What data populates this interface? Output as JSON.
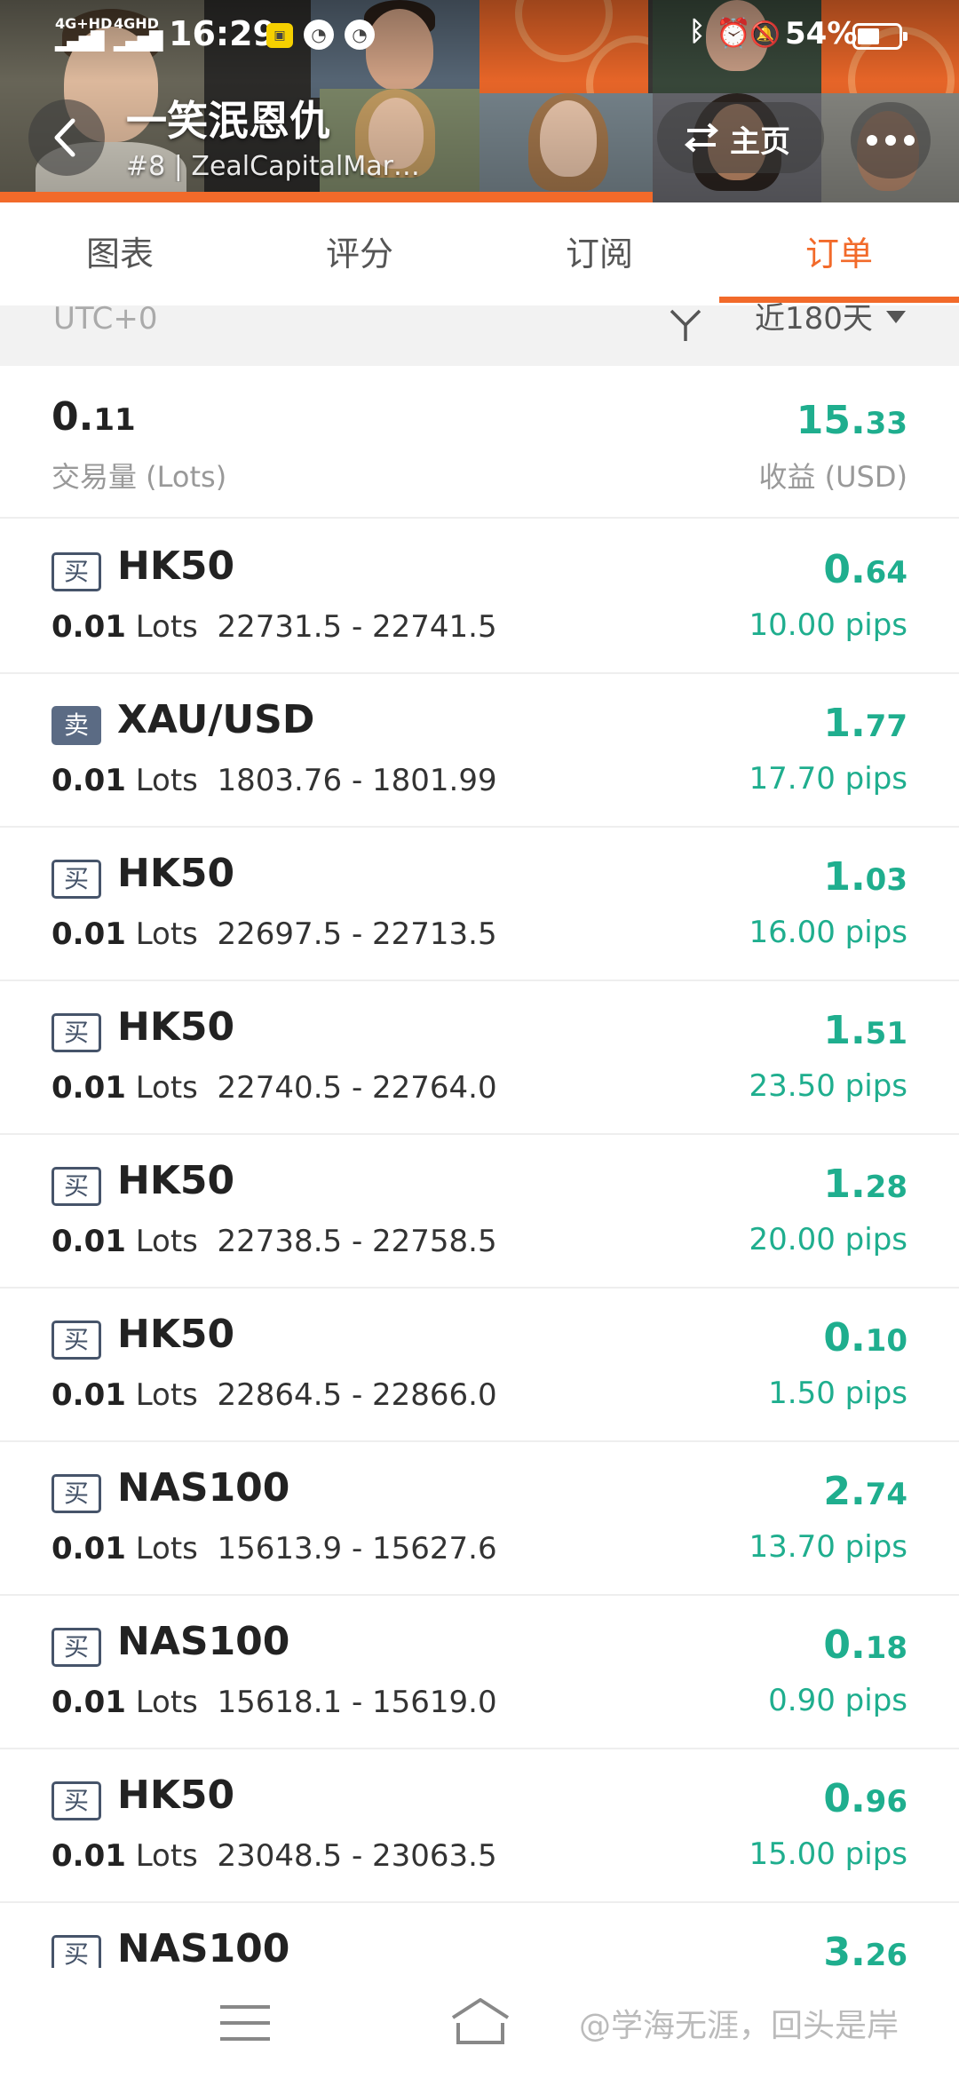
{
  "status_bar": {
    "net1": "4G+HD",
    "net2": "4GHD",
    "time": "16:29",
    "battery": "54%",
    "battery_level": 0.54
  },
  "header": {
    "title": "一笑泯恩仇",
    "subtitle": "#8 | ZealCapitalMar…",
    "home_label": "主页"
  },
  "tabs": [
    "图表",
    "评分",
    "订阅",
    "订单"
  ],
  "active_tab": 3,
  "filter": {
    "timezone": "UTC+0",
    "range": "近180天"
  },
  "summary": {
    "volume_int": "0.",
    "volume_dec": "11",
    "volume_label": "交易量 (Lots)",
    "profit_int": "15.",
    "profit_dec": "33",
    "profit_label": "收益 (USD)"
  },
  "orders": [
    {
      "side": "买",
      "type": "buy",
      "symbol": "HK50",
      "lots": "0.01",
      "unit": "Lots",
      "prices": "22731.5 - 22741.5",
      "pnl_int": "0.",
      "pnl_dec": "64",
      "pips": "10.00 pips"
    },
    {
      "side": "卖",
      "type": "sell",
      "symbol": "XAU/USD",
      "lots": "0.01",
      "unit": "Lots",
      "prices": "1803.76 - 1801.99",
      "pnl_int": "1.",
      "pnl_dec": "77",
      "pips": "17.70 pips"
    },
    {
      "side": "买",
      "type": "buy",
      "symbol": "HK50",
      "lots": "0.01",
      "unit": "Lots",
      "prices": "22697.5 - 22713.5",
      "pnl_int": "1.",
      "pnl_dec": "03",
      "pips": "16.00 pips"
    },
    {
      "side": "买",
      "type": "buy",
      "symbol": "HK50",
      "lots": "0.01",
      "unit": "Lots",
      "prices": "22740.5 - 22764.0",
      "pnl_int": "1.",
      "pnl_dec": "51",
      "pips": "23.50 pips"
    },
    {
      "side": "买",
      "type": "buy",
      "symbol": "HK50",
      "lots": "0.01",
      "unit": "Lots",
      "prices": "22738.5 - 22758.5",
      "pnl_int": "1.",
      "pnl_dec": "28",
      "pips": "20.00 pips"
    },
    {
      "side": "买",
      "type": "buy",
      "symbol": "HK50",
      "lots": "0.01",
      "unit": "Lots",
      "prices": "22864.5 - 22866.0",
      "pnl_int": "0.",
      "pnl_dec": "10",
      "pips": "1.50 pips"
    },
    {
      "side": "买",
      "type": "buy",
      "symbol": "NAS100",
      "lots": "0.01",
      "unit": "Lots",
      "prices": "15613.9 - 15627.6",
      "pnl_int": "2.",
      "pnl_dec": "74",
      "pips": "13.70 pips"
    },
    {
      "side": "买",
      "type": "buy",
      "symbol": "NAS100",
      "lots": "0.01",
      "unit": "Lots",
      "prices": "15618.1 - 15619.0",
      "pnl_int": "0.",
      "pnl_dec": "18",
      "pips": "0.90 pips"
    },
    {
      "side": "买",
      "type": "buy",
      "symbol": "HK50",
      "lots": "0.01",
      "unit": "Lots",
      "prices": "23048.5 - 23063.5",
      "pnl_int": "0.",
      "pnl_dec": "96",
      "pips": "15.00 pips"
    },
    {
      "side": "买",
      "type": "buy",
      "symbol": "NAS100",
      "lots": "",
      "unit": "",
      "prices": "",
      "pnl_int": "3.",
      "pnl_dec": "26",
      "pips": ""
    }
  ],
  "watermark": "@学海无涯，回头是岸",
  "icons": {
    "back": "chevron-left-icon",
    "swap": "swap-arrows-icon",
    "more": "more-dots-icon",
    "filter": "funnel-icon",
    "dropdown": "caret-down-icon",
    "nav_menu": "menu-lines-icon",
    "nav_home": "home-icon"
  },
  "colors": {
    "accent": "#f26a2a",
    "profit": "#1fae8e",
    "buy_badge": "#46546a",
    "sell_badge": "#5b6b84"
  }
}
